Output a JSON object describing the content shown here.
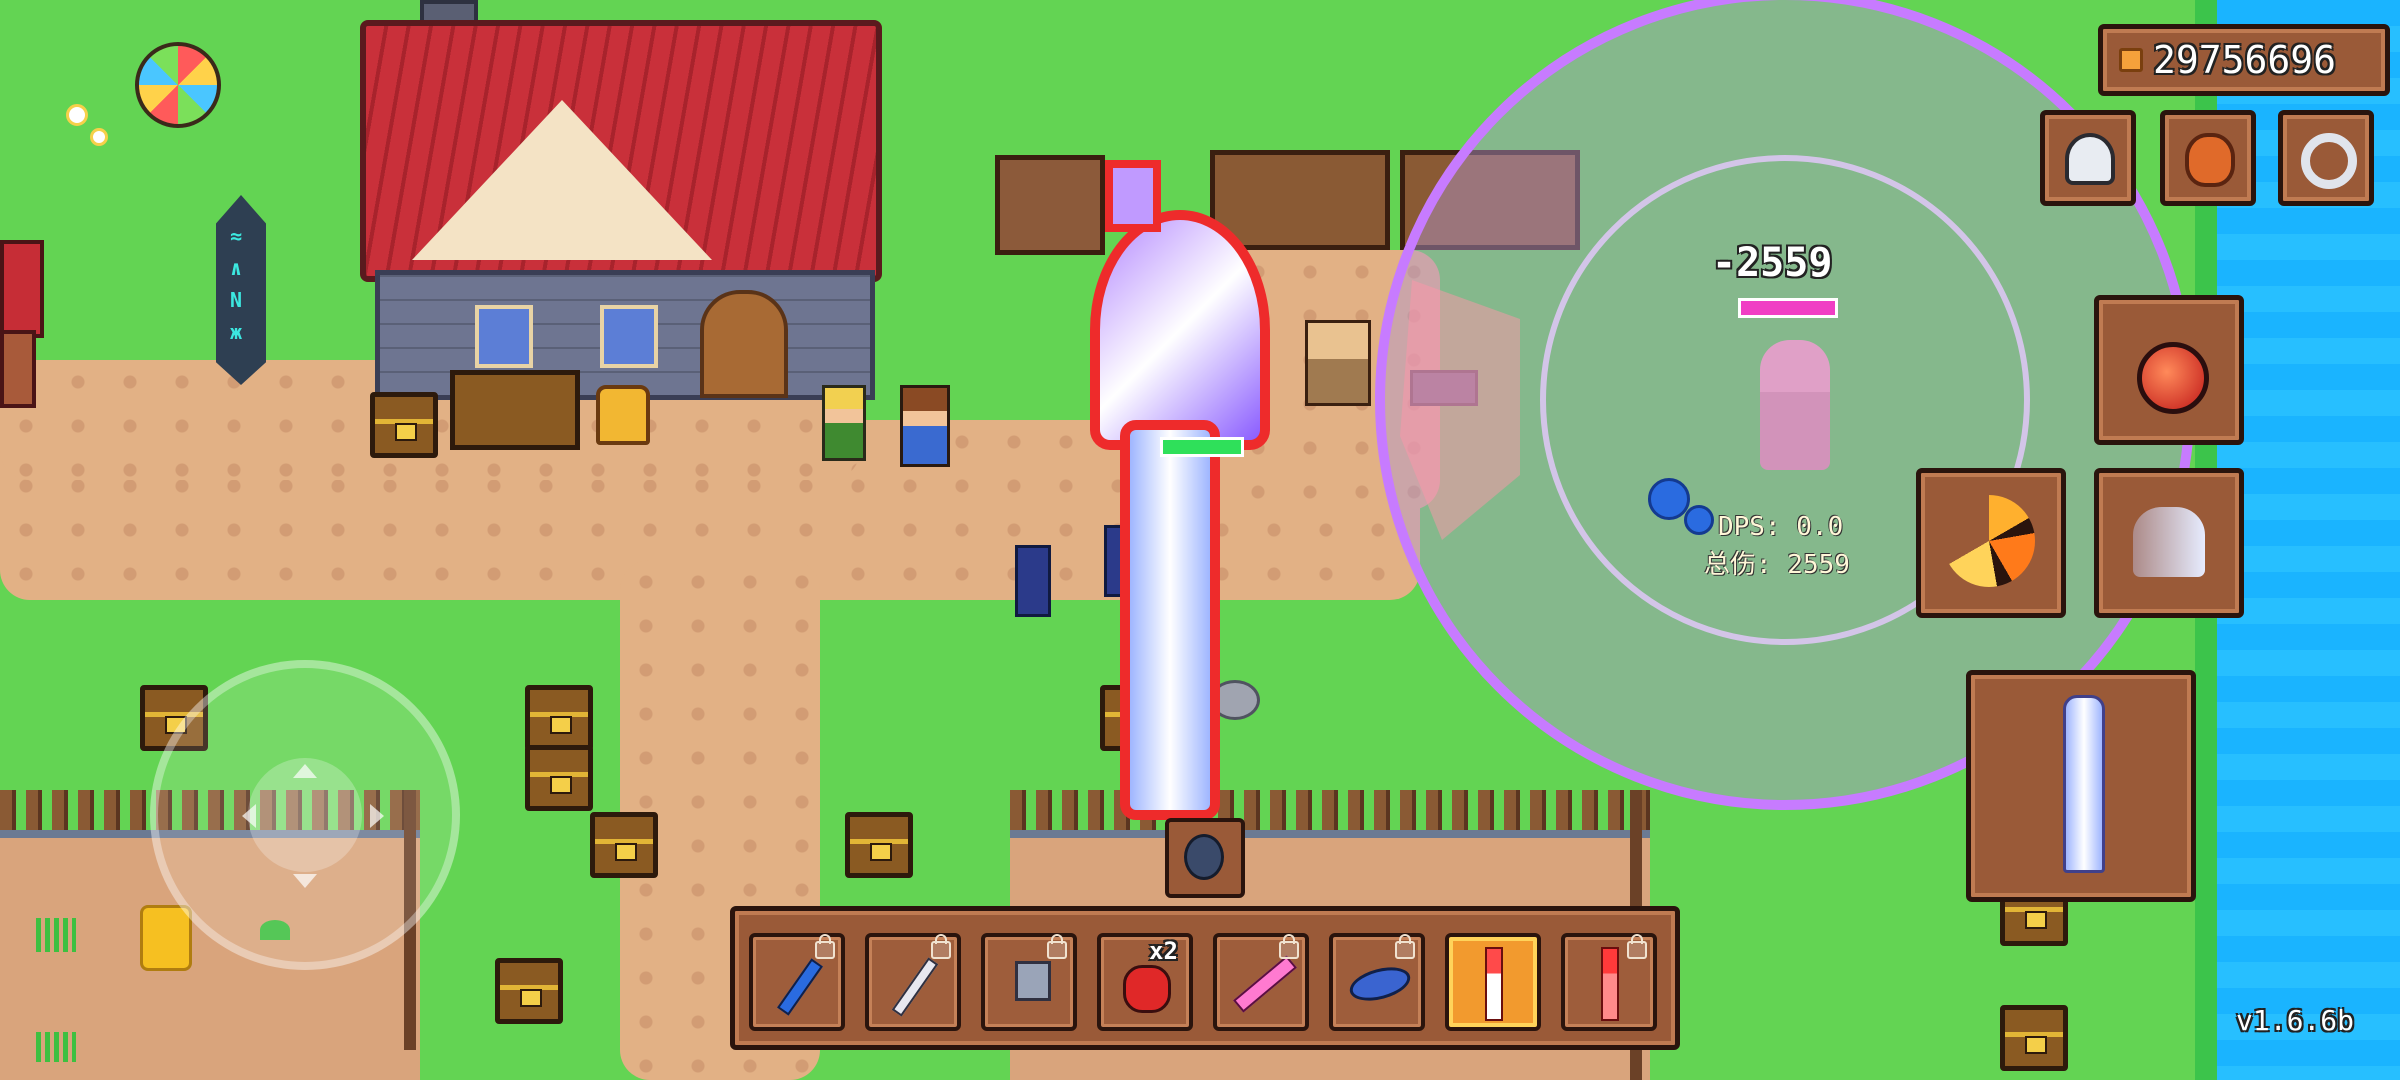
{
  "hud": {
    "coins": "29756696",
    "version": "v1.6.6b"
  },
  "combat": {
    "damage_popup": "-2559",
    "dps_label": "DPS: 0.0",
    "total_damage_label": "总伤: 2559"
  },
  "hotbar": {
    "slots": [
      {
        "icon": "blue-staff-icon",
        "locked": true
      },
      {
        "icon": "fishing-rod-icon",
        "locked": true
      },
      {
        "icon": "axe-icon",
        "locked": true
      },
      {
        "icon": "red-potion-icon",
        "locked": false,
        "badge": "x2"
      },
      {
        "icon": "pink-sword-icon",
        "locked": true
      },
      {
        "icon": "blue-fish-icon",
        "locked": true
      },
      {
        "icon": "crystal-staff-icon",
        "locked": false,
        "active": true
      },
      {
        "icon": "red-staff-icon",
        "locked": true
      }
    ]
  },
  "colors": {
    "coin": "#f6a13b",
    "aura_ring": "#c77bff",
    "health_bar": "#2fe05a",
    "enemy_health": "#f03fc4"
  }
}
